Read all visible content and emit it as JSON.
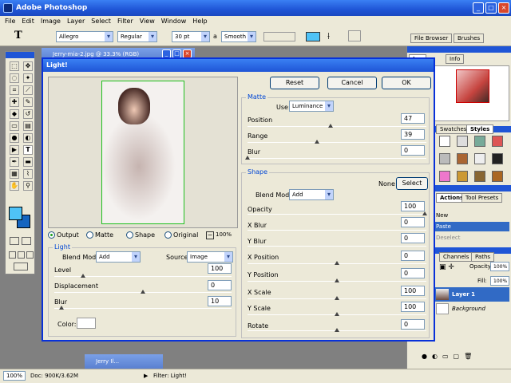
{
  "app": {
    "title": "Adobe Photoshop"
  },
  "menu": [
    "File",
    "Edit",
    "Image",
    "Layer",
    "Select",
    "Filter",
    "View",
    "Window",
    "Help"
  ],
  "options": {
    "tool_glyph": "T",
    "font": "Allegro",
    "style": "Regular",
    "size": "30 pt",
    "aa_label": "a",
    "aa": "Smooth"
  },
  "right_tabs": {
    "file_browser": "File Browser",
    "brushes": "Brushes"
  },
  "documents": {
    "doc1_title": "Jerry-mia-2.jpg @ 33.3% (RGB)",
    "doc2_title": "Jerry Il..."
  },
  "nav_tabs": {
    "tab1": "tor",
    "tab2": "Info"
  },
  "styles_tabs": {
    "swatches": "Swatches",
    "styles": "Styles"
  },
  "actions_tabs": {
    "actions": "Actions",
    "presets": "Tool Presets",
    "items": [
      "New",
      "Paste",
      "Deselect"
    ]
  },
  "layers_panel": {
    "channels": "Channels",
    "paths": "Paths",
    "opacity_label": "Opacity:",
    "opacity": "100%",
    "fill_label": "Fill:",
    "fill": "100%",
    "layer1": "Layer 1",
    "background": "Background"
  },
  "dialog": {
    "title": "Light!",
    "reset": "Reset",
    "cancel": "Cancel",
    "ok": "OK",
    "radios": {
      "output": "Output",
      "matte": "Matte",
      "shape": "Shape",
      "original": "Original"
    },
    "zoom": "100%",
    "light": {
      "title": "Light",
      "blend_label": "Blend Mode:",
      "blend": "Add",
      "source_label": "Source:",
      "source": "Image",
      "level_label": "Level",
      "level": "100",
      "displacement_label": "Displacement",
      "displacement": "0",
      "blur_label": "Blur",
      "blur": "10",
      "color_label": "Color:"
    },
    "matte": {
      "title": "Matte",
      "use_label": "Use:",
      "use": "Luminance",
      "position_label": "Position",
      "position": "47",
      "range_label": "Range",
      "range": "39",
      "blur_label": "Blur",
      "blur": "0"
    },
    "shape": {
      "title": "Shape",
      "none": "None",
      "select": "Select",
      "blend_label": "Blend Mode:",
      "blend": "Add",
      "opacity_label": "Opacity",
      "opacity": "100",
      "xblur_label": "X Blur",
      "xblur": "0",
      "yblur_label": "Y Blur",
      "yblur": "0",
      "xpos_label": "X Position",
      "xpos": "0",
      "ypos_label": "Y Position",
      "ypos": "0",
      "xscale_label": "X Scale",
      "xscale": "100",
      "yscale_label": "Y Scale",
      "yscale": "100",
      "rotate_label": "Rotate",
      "rotate": "0"
    }
  },
  "status": {
    "zoom": "100%",
    "doc": "Doc: 900K/3.62M",
    "filter": "Filter: Light!"
  },
  "colors": {
    "accent": "#0831d9",
    "foreground": "#4fc3f7",
    "background": "#1565c0"
  }
}
